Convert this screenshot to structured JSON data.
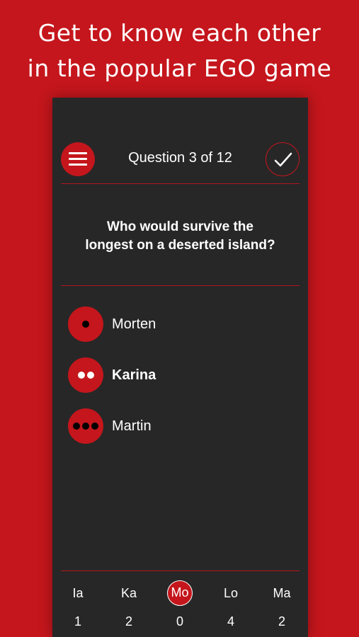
{
  "promo": {
    "line1": "Get to know each other",
    "line2": "in the popular EGO game"
  },
  "header": {
    "menu_icon": "hamburger-menu-icon",
    "title": "Question 3 of 12",
    "confirm_icon": "checkmark-icon"
  },
  "question": {
    "line1": "Who would survive the",
    "line2": "longest on a deserted island?"
  },
  "options": [
    {
      "name": "Morten",
      "dots": 1,
      "dot_color": "#000000",
      "selected": false
    },
    {
      "name": "Karina",
      "dots": 2,
      "dot_color": "#ffffff",
      "selected": true
    },
    {
      "name": "Martin",
      "dots": 3,
      "dot_color": "#000000",
      "selected": false
    }
  ],
  "players": [
    {
      "abbr": "Ia",
      "score": "1",
      "active": false
    },
    {
      "abbr": "Ka",
      "score": "2",
      "active": false
    },
    {
      "abbr": "Mo",
      "score": "0",
      "active": true
    },
    {
      "abbr": "Lo",
      "score": "4",
      "active": false
    },
    {
      "abbr": "Ma",
      "score": "2",
      "active": false
    }
  ],
  "colors": {
    "brand_red": "#c4161c",
    "panel_bg": "#272727",
    "text": "#ffffff"
  }
}
